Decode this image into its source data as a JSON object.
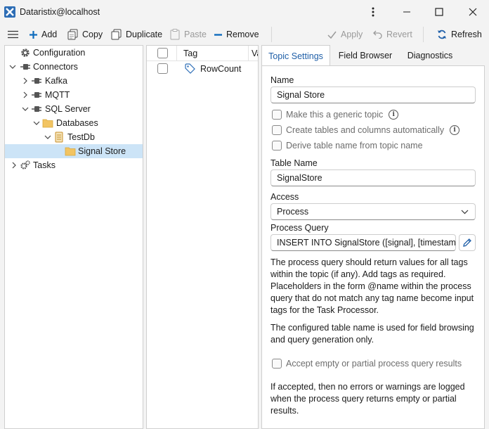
{
  "window": {
    "title": "Dataristix@localhost",
    "controls": [
      "more-icon",
      "minimize-icon",
      "maximize-icon",
      "close-icon"
    ]
  },
  "toolbar": {
    "add": "Add",
    "copy": "Copy",
    "duplicate": "Duplicate",
    "paste": "Paste",
    "remove": "Remove",
    "apply": "Apply",
    "revert": "Revert",
    "refresh": "Refresh"
  },
  "tree": {
    "configuration": "Configuration",
    "connectors": "Connectors",
    "kafka": "Kafka",
    "mqtt": "MQTT",
    "sql_server": "SQL Server",
    "databases": "Databases",
    "testdb": "TestDb",
    "signal_store": "Signal Store",
    "tasks": "Tasks"
  },
  "tag_list": {
    "columns": [
      "Tag",
      "Va"
    ],
    "rows": [
      {
        "name": "RowCount",
        "checked": false
      }
    ]
  },
  "tabs": [
    "Topic Settings",
    "Field Browser",
    "Diagnostics"
  ],
  "topic": {
    "name_label": "Name",
    "name_value": "Signal Store",
    "generic_topic": "Make this a generic topic",
    "create_tables": "Create tables and columns automatically",
    "derive_table": "Derive table name from topic name",
    "table_name_label": "Table Name",
    "table_name_value": "SignalStore",
    "access_label": "Access",
    "access_value": "Process",
    "process_query_label": "Process Query",
    "process_query_value": "INSERT INTO SignalStore ([signal], [timestamp]",
    "help1": "The process query should return values for all tags within the topic (if any). Add tags as required. Placeholders in the form @name within the process query that do not match any tag name become input tags for the Task Processor.",
    "help2": "The configured table name is used for field browsing and query generation only.",
    "accept_empty": "Accept empty or partial process query results",
    "help3": "If accepted, then no errors or warnings are logged when the process query returns empty or partial results."
  },
  "colors": {
    "accent": "#0f6cbd",
    "selection": "#cce4f7",
    "folder": "#f2c462",
    "active_tab_text": "#1f5fa8"
  }
}
